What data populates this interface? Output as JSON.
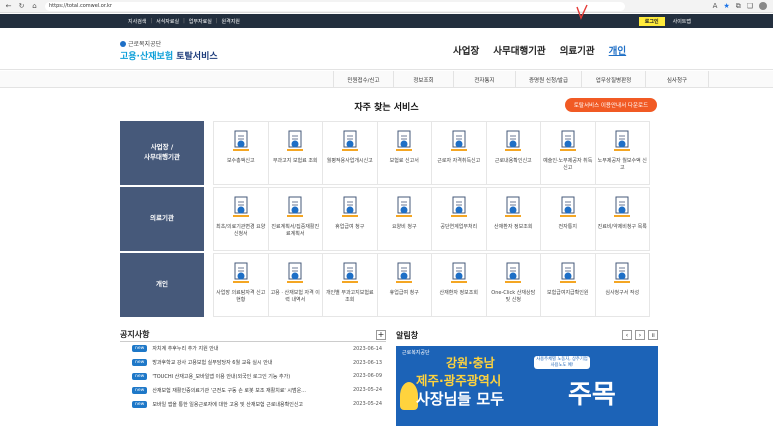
{
  "browser": {
    "url": "https://total.comwel.or.kr"
  },
  "topbar": {
    "links": [
      "지사검색",
      "서식자료실",
      "업무자료실",
      "원격지원"
    ],
    "login": "로그인",
    "sitemap": "사이트맵"
  },
  "header": {
    "logo_small": "근로복지공단",
    "logo_big_a": "고용·산재보험",
    "logo_big_b": " 토탈서비스",
    "nav": [
      "사업장",
      "사무대행기관",
      "의료기관",
      "개인"
    ]
  },
  "subnav": {
    "items": [
      "민원접수/신고",
      "정보조회",
      "전자통지",
      "증명원 신청/발급",
      "업무상질병판정",
      "심사청구"
    ]
  },
  "services": {
    "title": "자주 찾는 서비스",
    "download_button": "토탈서비스 이용안내서 다운로드",
    "rows": [
      {
        "label": "사업장 /\n사무대행기관",
        "items": [
          "보수총액신고",
          "부과고지 보험료 조회",
          "월평적용사업개시신고",
          "보험료 신고서",
          "근로자 자격취득신고",
          "근로내용확인신고",
          "예술인·노무제공자 취득신고",
          "노무제공자 월보수액 신고"
        ]
      },
      {
        "label": "의료기관",
        "items": [
          "최초/의료기관변경 요양신청서",
          "진료계획서/집중재활진료계획서",
          "휴업급여 청구",
          "요양비 청구",
          "공단연계업무처리",
          "산재환자 정보조회",
          "전자통지",
          "진료비/약제비청구 목록"
        ]
      },
      {
        "label": "개인",
        "items": [
          "사업장 의료탐자격 신고현황",
          "고용 · 산재보험 자격 이력 내역서",
          "개인별 부과고지보험료 조회",
          "휴업급여 청구",
          "산재환자 정보조회",
          "One-Click 산재상담 및 신청",
          "보험급여지급확인원",
          "심사청구서 작성"
        ]
      }
    ]
  },
  "notices": {
    "title": "공지사항",
    "plus": "+",
    "badge": "new",
    "items": [
      {
        "text": "자치계 추후누리 추가 지원 안내",
        "date": "2023-06-14"
      },
      {
        "text": "방과후학교 강사 고용보험 실무담당자 6월 교육 실시 안내",
        "date": "2023-06-13"
      },
      {
        "text": "'TOUCHI 산재고용_모바일앱 이용 안내(외국인 로그인 기능 추가)",
        "date": "2023-06-09"
      },
      {
        "text": "산재보험 재활인증의료기관 '근전도 구동 손 로봇 보조 재활치료' 시범운...",
        "date": "2023-05-24"
      },
      {
        "text": "모바일 앱을 통한 일용근로자에 대한 고용 및 산재보험 근로내용확인신고",
        "date": "2023-05-24"
      }
    ]
  },
  "alerts": {
    "title": "알림창",
    "controls": [
      "‹",
      "›",
      "॥"
    ],
    "banner": {
      "org": "근로복지공단",
      "line1": "강원·충남",
      "line2": "제주·광주광역시",
      "line3": "사장님들 모두",
      "side": "사용주체별 노동자, 상주기업 사용노도 예!",
      "big": "주목"
    }
  },
  "colors": {
    "topbar": "#232f3e",
    "row_label": "#46597a",
    "accent_orange": "#f15a24",
    "brand_blue": "#1e6fc6",
    "banner": "#1c63b7"
  }
}
